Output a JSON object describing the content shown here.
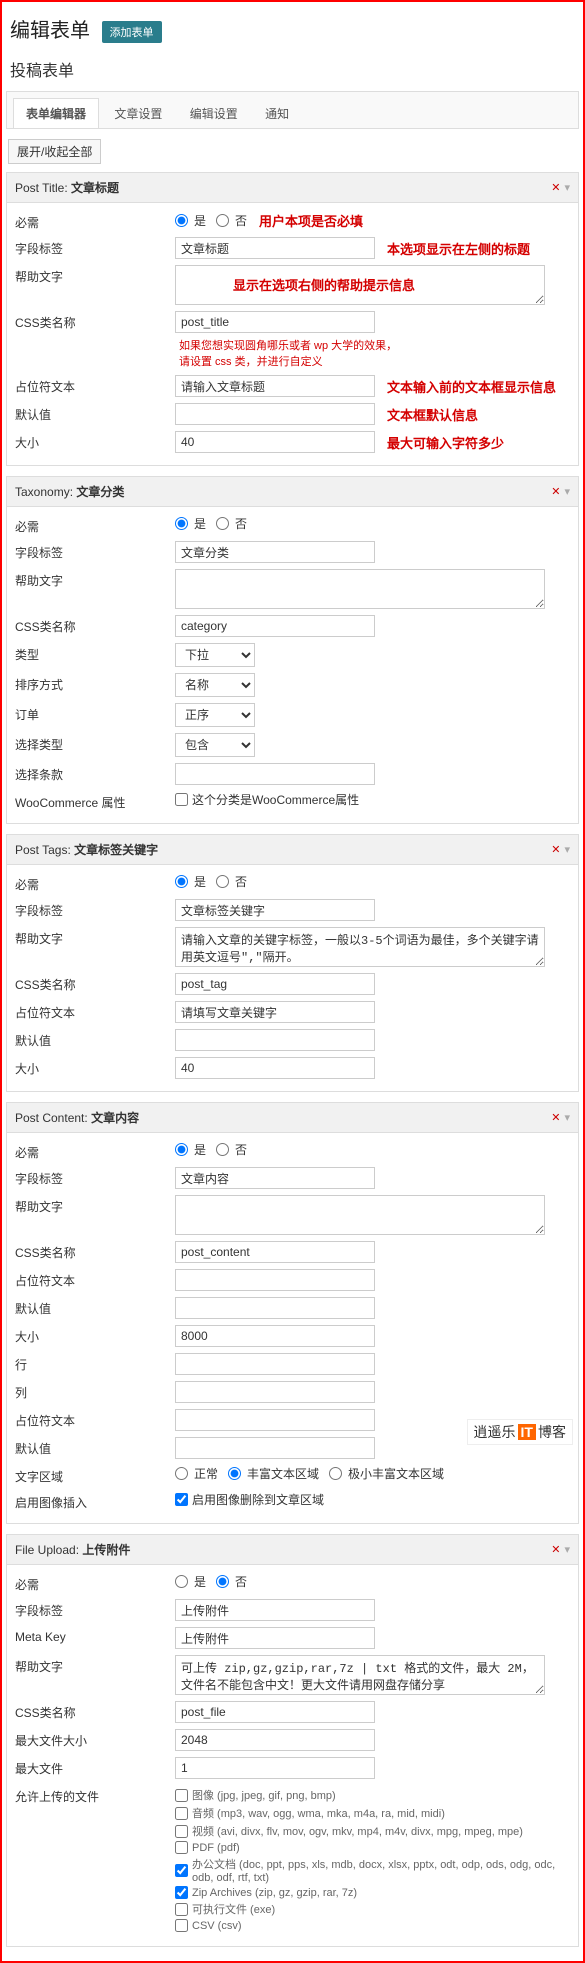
{
  "header": {
    "title": "编辑表单",
    "addNew": "添加表单"
  },
  "formName": "投稿表单",
  "tabs": [
    "表单编辑器",
    "文章设置",
    "编辑设置",
    "通知"
  ],
  "toggleAll": "展开/收起全部",
  "common": {
    "requiredLabel": "必需",
    "fieldLabel": "字段标签",
    "helpText": "帮助文字",
    "cssClass": "CSS类名称",
    "placeholder": "占位符文本",
    "default": "默认值",
    "size": "大小",
    "yes": "是",
    "no": "否"
  },
  "post_title": {
    "head": "Post Title:",
    "headName": "文章标题",
    "note_required": "用户本项是否必填",
    "label": "文章标题",
    "note_label": "本选项显示在左侧的标题",
    "note_help": "显示在选项右侧的帮助提示信息",
    "note_css1": "如果您想实现圆角哪乐或者 wp 大学的效果，",
    "note_css2": "请设置 css 类，并进行自定义",
    "css": "post_title",
    "ph": "请输入文章标题",
    "note_ph": "文本输入前的文本框显示信息",
    "note_def": "文本框默认信息",
    "size": "40",
    "note_size": "最大可输入字符多少"
  },
  "taxonomy": {
    "head": "Taxonomy:",
    "headName": "文章分类",
    "label": "文章分类",
    "css": "category",
    "typeLabel": "类型",
    "type": "下拉",
    "orderByLabel": "排序方式",
    "orderBy": "名称",
    "orderLabel": "订单",
    "order": "正序",
    "selTypeLabel": "选择类型",
    "selType": "包含",
    "selCondLabel": "选择条款",
    "wcLabel": "WooCommerce 属性",
    "wcText": "这个分类是WooCommerce属性"
  },
  "post_tags": {
    "head": "Post Tags:",
    "headName": "文章标签关键字",
    "label": "文章标签关键字",
    "help": "请输入文章的关键字标签，一般以3-5个词语为最佳，多个关键字请用英文逗号\",\"隔开。",
    "css": "post_tag",
    "ph": "请填写文章关键字",
    "size": "40"
  },
  "post_content": {
    "head": "Post Content:",
    "headName": "文章内容",
    "label": "文章内容",
    "css": "post_content",
    "size": "8000",
    "rowsLabel": "行",
    "colsLabel": "列",
    "areaLabel": "文字区域",
    "opt1": "正常",
    "opt2": "丰富文本区域",
    "opt3": "极小丰富文本区域",
    "imgInsertLabel": "启用图像插入",
    "imgInsertText": "启用图像删除到文章区域"
  },
  "file_upload": {
    "head": "File Upload:",
    "headName": "上传附件",
    "label": "上传附件",
    "metaKeyLabel": "Meta Key",
    "metaKey": "上传附件",
    "help": "可上传 zip,gz,gzip,rar,7z | txt 格式的文件，最大 2M，文件名不能包含中文！更大文件请用网盘存储分享",
    "css": "post_file",
    "maxSizeLabel": "最大文件大小",
    "maxSize": "2048",
    "maxFilesLabel": "最大文件",
    "maxFiles": "1",
    "allowedLabel": "允许上传的文件",
    "types": [
      {
        "checked": false,
        "text": "图像 (jpg, jpeg, gif, png, bmp)"
      },
      {
        "checked": false,
        "text": "音频 (mp3, wav, ogg, wma, mka, m4a, ra, mid, midi)"
      },
      {
        "checked": false,
        "text": "视频 (avi, divx, flv, mov, ogv, mkv, mp4, m4v, divx, mpg, mpeg, mpe)"
      },
      {
        "checked": false,
        "text": "PDF (pdf)"
      },
      {
        "checked": true,
        "text": "办公文档 (doc, ppt, pps, xls, mdb, docx, xlsx, pptx, odt, odp, ods, odg, odc, odb, odf, rtf, txt)"
      },
      {
        "checked": true,
        "text": "Zip Archives (zip, gz, gzip, rar, 7z)"
      },
      {
        "checked": false,
        "text": "可执行文件 (exe)"
      },
      {
        "checked": false,
        "text": "CSV (csv)"
      }
    ]
  },
  "watermark": {
    "t1": "逍遥乐",
    "it": "IT",
    "t2": "博客"
  }
}
